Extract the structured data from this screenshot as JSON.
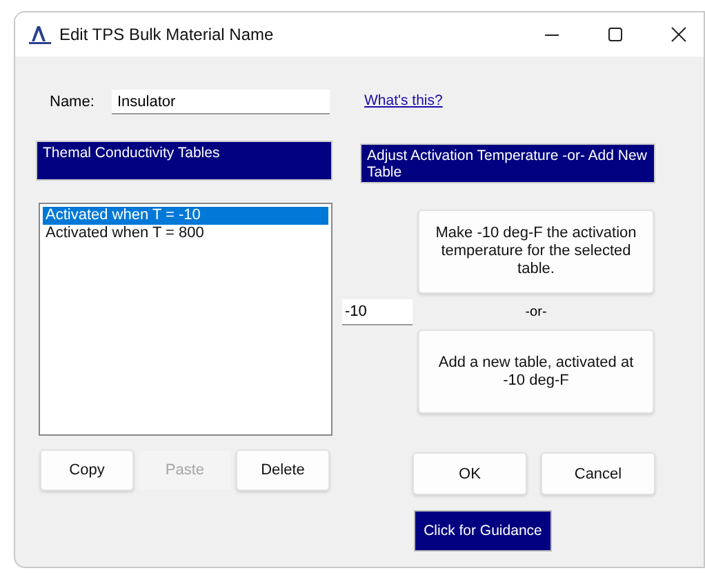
{
  "window": {
    "title": "Edit TPS Bulk Material Name"
  },
  "name_field": {
    "label": "Name:",
    "value": "Insulator"
  },
  "help_link": "What's this?",
  "tables_panel": {
    "header": "Themal Conductivity Tables",
    "items": [
      {
        "label": "Activated when T = -10",
        "selected": true
      },
      {
        "label": "Activated when T = 800",
        "selected": false
      }
    ],
    "buttons": [
      {
        "label": "Copy",
        "disabled": false
      },
      {
        "label": "Paste",
        "disabled": true
      },
      {
        "label": "Delete",
        "disabled": false
      }
    ]
  },
  "activation_panel": {
    "header": "Adjust Activation Temperature -or- Add New Table",
    "temperature": "-10",
    "make_button": "Make -10 deg-F the activation temperature for the selected table.",
    "separator": "-or-",
    "add_button": "Add a new table, activated at -10 deg-F"
  },
  "dialog_buttons": [
    "OK",
    "Cancel"
  ],
  "guidance_button": "Click for Guidance"
}
